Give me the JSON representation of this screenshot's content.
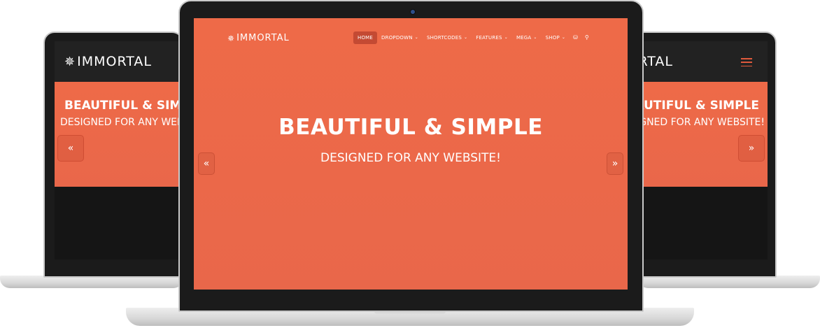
{
  "brand": {
    "logo_text": "IMMORTAL",
    "accent_color": "#ee6a48",
    "header_dark": "#222222"
  },
  "nav": {
    "items": [
      {
        "label": "HOME",
        "active": true,
        "has_dropdown": false
      },
      {
        "label": "DROPDOWN",
        "active": false,
        "has_dropdown": true
      },
      {
        "label": "SHORTCODES",
        "active": false,
        "has_dropdown": true
      },
      {
        "label": "FEATURES",
        "active": false,
        "has_dropdown": true
      },
      {
        "label": "MEGA",
        "active": false,
        "has_dropdown": true
      },
      {
        "label": "SHOP",
        "active": false,
        "has_dropdown": true
      }
    ],
    "icons": [
      "cart-icon",
      "search-icon"
    ],
    "caret": "⌄",
    "cart_glyph": "⛁",
    "search_glyph": "⚲"
  },
  "slider": {
    "headline": "BEAUTIFUL & SIMPLE",
    "subline": "DESIGNED FOR ANY WEBSITE!",
    "prev_glyph": "«",
    "next_glyph": "»"
  },
  "left_device": {
    "headline": "BEAUTIFUL & SIMPLE",
    "subline": "DESIGNED FOR ANY WEBSITE!"
  },
  "right_device": {
    "headline": "BEAUTIFUL & SIMPLE",
    "subline": "DESIGNED FOR ANY WEBSITE!"
  }
}
